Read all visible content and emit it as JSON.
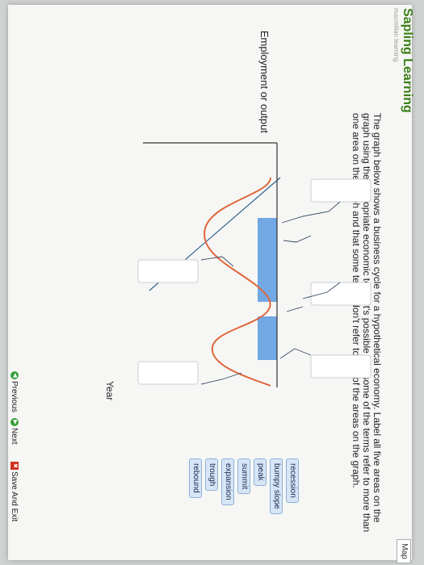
{
  "app": {
    "brand_title": "Sapling Learning",
    "brand_sub": "macmillan learning",
    "map_label": "Map"
  },
  "question": {
    "instructions": "The graph below shows a business cycle for a hypothetical economy. Label all five areas on the graph using the appropriate economic term. It's possible that some of the terms refer to more than one area on the graph and that some terms don't refer to any of the areas on the graph."
  },
  "graph": {
    "y_label": "Employment or output",
    "x_label": "Year",
    "colors": {
      "cycle": "#e0673b",
      "trend": "#2e5f8a",
      "band": "#5b9ae0",
      "axis": "#333333",
      "drop_target_border": "#c9ced6"
    }
  },
  "terms": [
    "recession",
    "bumpy slope",
    "peak",
    "summit",
    "expansion",
    "trough",
    "rebound"
  ],
  "footer": {
    "previous": "Previous",
    "next": "Next",
    "save_exit": "Save And Exit"
  }
}
